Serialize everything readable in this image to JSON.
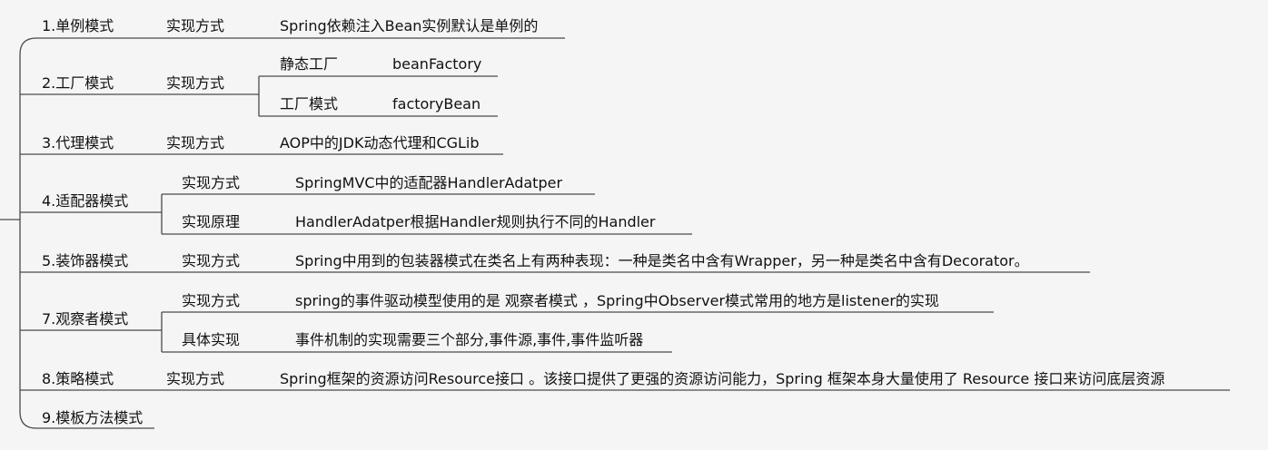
{
  "patterns": [
    {
      "name": "1.单例模式",
      "method": "实现方式",
      "detail": "Spring依赖注入Bean实例默认是单例的"
    },
    {
      "name": "2.工厂模式",
      "method": "实现方式",
      "items": [
        {
          "label": "静态工厂",
          "value": "beanFactory"
        },
        {
          "label": "工厂模式",
          "value": "factoryBean"
        }
      ]
    },
    {
      "name": "3.代理模式",
      "method": "实现方式",
      "detail": "AOP中的JDK动态代理和CGLib"
    },
    {
      "name": "4.适配器模式",
      "items": [
        {
          "label": "实现方式",
          "value": "SpringMVC中的适配器HandlerAdatper"
        },
        {
          "label": "实现原理",
          "value": "HandlerAdatper根据Handler规则执行不同的Handler"
        }
      ]
    },
    {
      "name": "5.装饰器模式",
      "method": "实现方式",
      "detail": "Spring中用到的包装器模式在类名上有两种表现：一种是类名中含有Wrapper，另一种是类名中含有Decorator。"
    },
    {
      "name": "7.观察者模式",
      "items": [
        {
          "label": "实现方式",
          "value": "spring的事件驱动模型使用的是 观察者模式 ，Spring中Observer模式常用的地方是listener的实现"
        },
        {
          "label": "具体实现",
          "value": "事件机制的实现需要三个部分,事件源,事件,事件监听器"
        }
      ]
    },
    {
      "name": "8.策略模式",
      "method": "实现方式",
      "detail": "Spring框架的资源访问Resource接口 。该接口提供了更强的资源访问能力，Spring 框架本身大量使用了 Resource 接口来访问底层资源"
    },
    {
      "name": "9.模板方法模式"
    }
  ]
}
